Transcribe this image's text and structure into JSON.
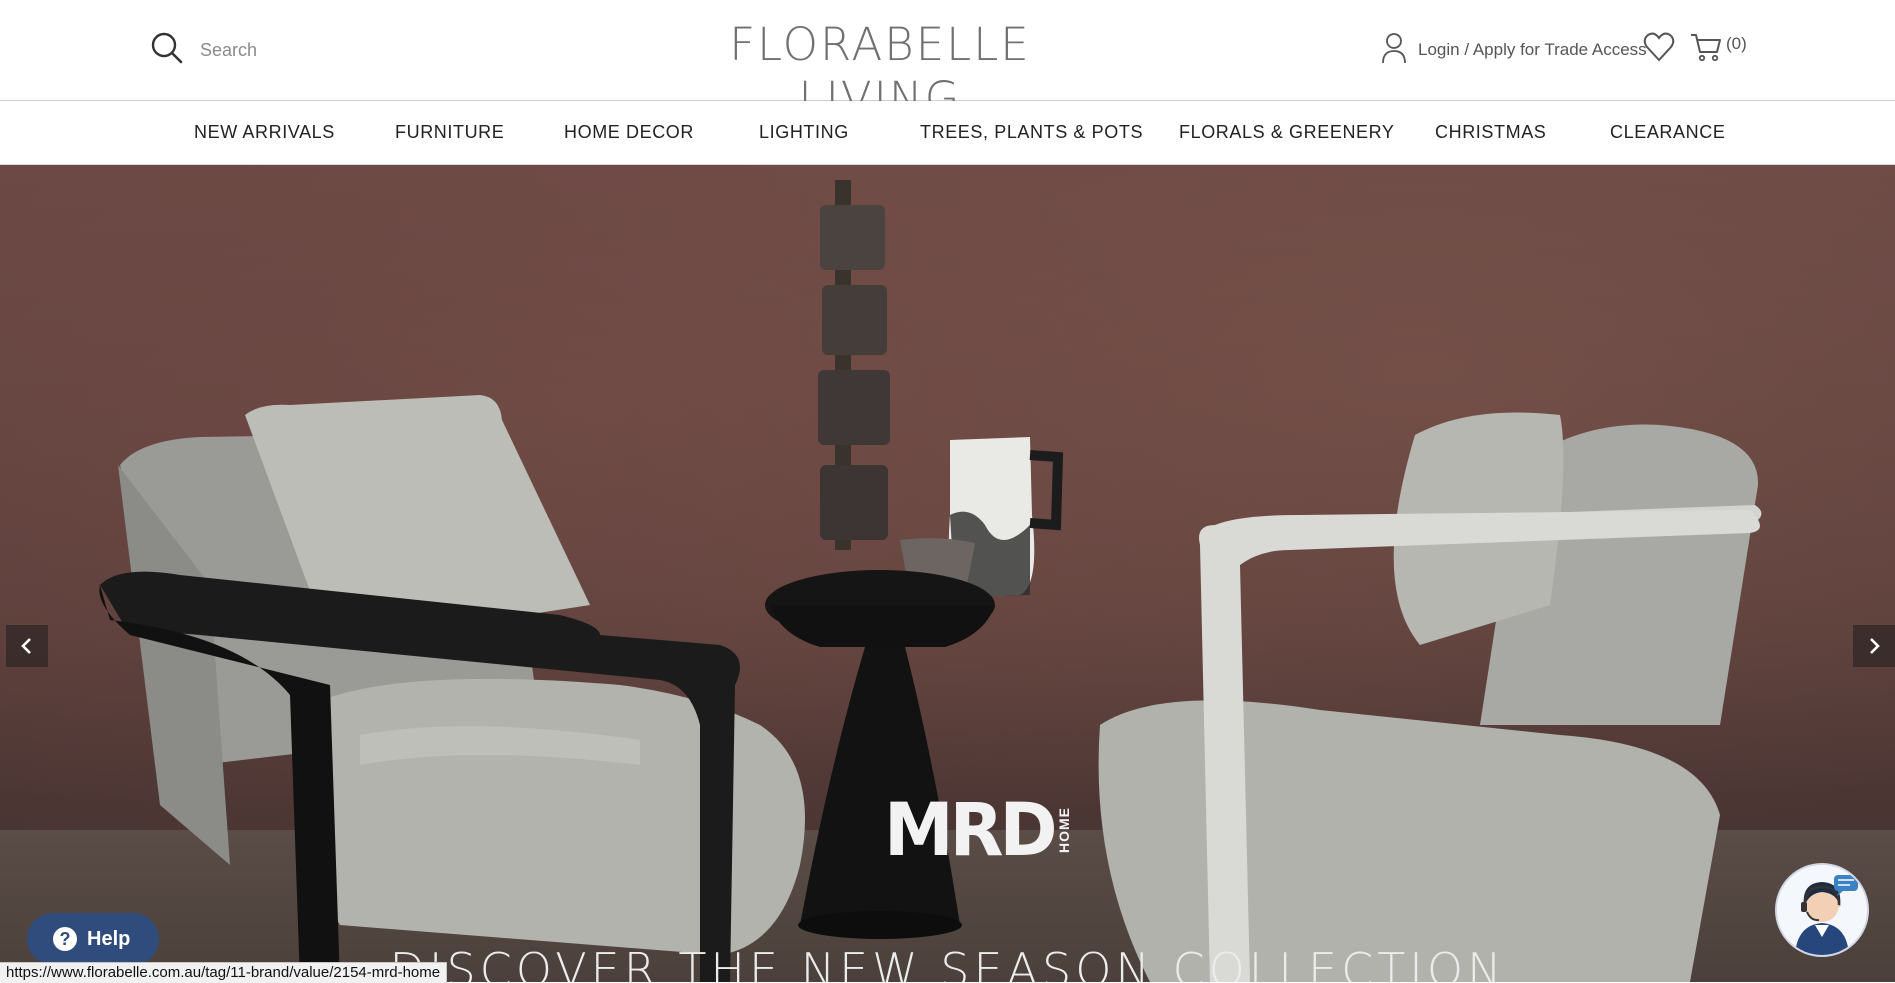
{
  "header": {
    "search_placeholder": "Search",
    "logo_text": "FLORABELLE LIVING",
    "account_label": "Login / Apply for Trade Access",
    "cart_count": "(0)"
  },
  "nav": {
    "items": [
      {
        "label": "NEW ARRIVALS"
      },
      {
        "label": "FURNITURE"
      },
      {
        "label": "HOME DECOR"
      },
      {
        "label": "LIGHTING"
      },
      {
        "label": "TREES, PLANTS & POTS"
      },
      {
        "label": "FLORALS & GREENERY"
      },
      {
        "label": "CHRISTMAS"
      },
      {
        "label": "CLEARANCE"
      }
    ]
  },
  "hero": {
    "brand_main": "MRD",
    "brand_sub": "HOME",
    "caption": "DISCOVER THE NEW SEASON COLLECTION"
  },
  "widgets": {
    "help_label": "Help",
    "help_icon_glyph": "?"
  },
  "status_bar": {
    "url": "https://www.florabelle.com.au/tag/11-brand/value/2154-mrd-home"
  },
  "colors": {
    "hero_wall": "#5b3f3b",
    "help_button": "#2f4c7c",
    "nav_text": "#222222"
  },
  "icons": [
    "search-icon",
    "user-icon",
    "heart-icon",
    "cart-icon",
    "chevron-left-icon",
    "chevron-right-icon",
    "help-icon",
    "chat-agent-icon"
  ]
}
